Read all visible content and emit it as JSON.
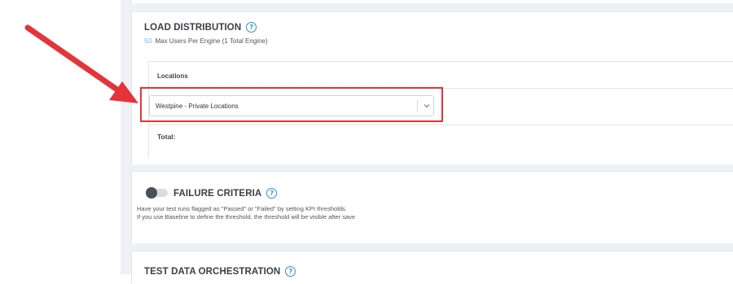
{
  "load_distribution": {
    "title": "LOAD DISTRIBUTION",
    "help_glyph": "?",
    "max_users_value": "50",
    "max_users_text": "Max Users Per Engine (1 Total Engine)",
    "locations_header": "Locations",
    "location_select": {
      "selected": "Westpine - Private Locations",
      "icon": "chevron-down-icon"
    },
    "total_label": "Total:"
  },
  "failure_criteria": {
    "title": "FAILURE CRITERIA",
    "help_glyph": "?",
    "toggle_on": false,
    "description_line1": "Have your test runs flagged as \"Passed\" or \"Failed\" by setting KPI thresholds.",
    "description_line2": "If you use Baseline to define the threshold, the threshold will be visible after save"
  },
  "test_data_orchestration": {
    "title": "TEST DATA ORCHESTRATION",
    "help_glyph": "?"
  },
  "annotation": {
    "arrow_color": "#e5333a",
    "highlight_color": "#e5333a"
  }
}
